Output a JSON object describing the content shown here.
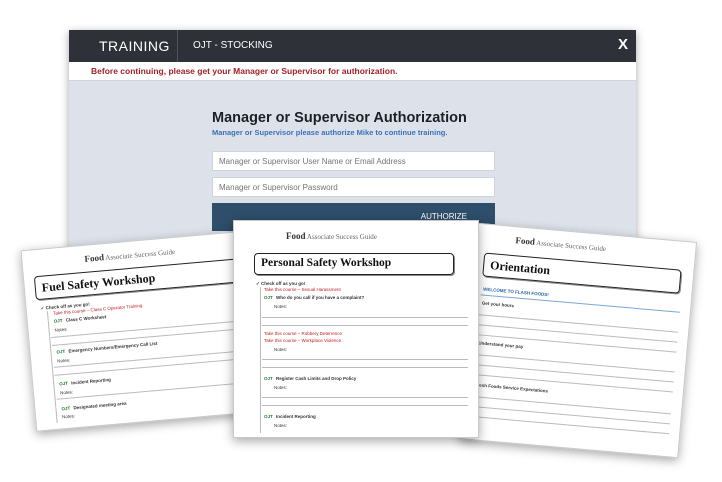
{
  "app": {
    "brand": "TRAINING",
    "breadcrumb": "OJT - STOCKING",
    "close": "X",
    "warning": "Before continuing, please get your Manager or Supervisor for authorization."
  },
  "auth": {
    "title": "Manager or Supervisor Authorization",
    "subtitle": "Manager or Supervisor please authorize Mike to continue training.",
    "username_placeholder": "Manager or Supervisor User Name or Email Address",
    "password_placeholder": "Manager or Supervisor Password",
    "button": "AUTHORIZE"
  },
  "docs": {
    "logo": "Associate Success Guide",
    "logo_mark": "Food",
    "left": {
      "title": "Fuel Safety Workshop",
      "check": "✓ Check off as you go!",
      "take": "Take this course – Class C Operator Training",
      "ojt": "OJT",
      "row1": "Class C Worksheet",
      "notes": "Notes:",
      "row2": "Emergency Numbers/Emergency Call List",
      "row3": "Incident Reporting",
      "row4": "Designated meeting area"
    },
    "mid": {
      "title": "Personal Safety Workshop",
      "check": "✓ Check off as you go!",
      "take1": "Take this course – Sexual Harassment",
      "row1": "Who do you call if you have a complaint?",
      "notes": "Notes:",
      "take2": "Take this course – Robbery Deterrence",
      "take3": "Take this course – Workplace Violence",
      "row2": "Register Cash Limits and Drop Policy",
      "row3": "Incident Reporting",
      "ojt": "OJT"
    },
    "right": {
      "title": "Orientation",
      "welcome": "WELCOME TO FLASH FOODS!",
      "r1": "Get your hours",
      "r2": "Understand your pay",
      "r3": "Fresh Foods Service Expectations"
    }
  }
}
